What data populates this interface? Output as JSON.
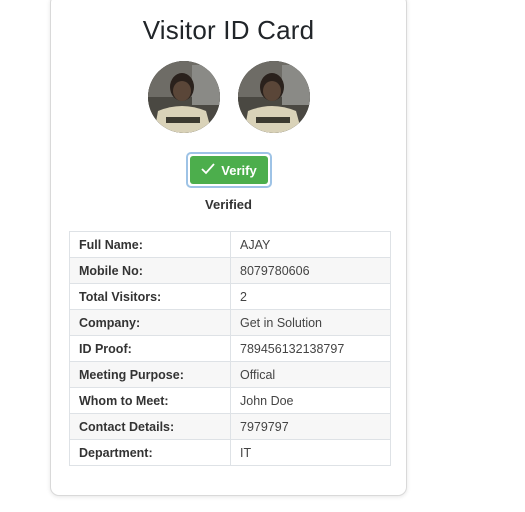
{
  "card": {
    "title": "Visitor ID Card",
    "verify_label": "Verify",
    "status": "Verified",
    "accent_color": "#4cae4c"
  },
  "details": [
    {
      "label": "Full Name:",
      "value": "AJAY"
    },
    {
      "label": "Mobile No:",
      "value": "8079780606"
    },
    {
      "label": "Total Visitors:",
      "value": "2"
    },
    {
      "label": "Company:",
      "value": "Get in Solution"
    },
    {
      "label": "ID Proof:",
      "value": "789456132138797"
    },
    {
      "label": "Meeting Purpose:",
      "value": "Offical"
    },
    {
      "label": "Whom to Meet:",
      "value": "John Doe"
    },
    {
      "label": "Contact Details:",
      "value": "7979797"
    },
    {
      "label": "Department:",
      "value": "IT"
    }
  ]
}
